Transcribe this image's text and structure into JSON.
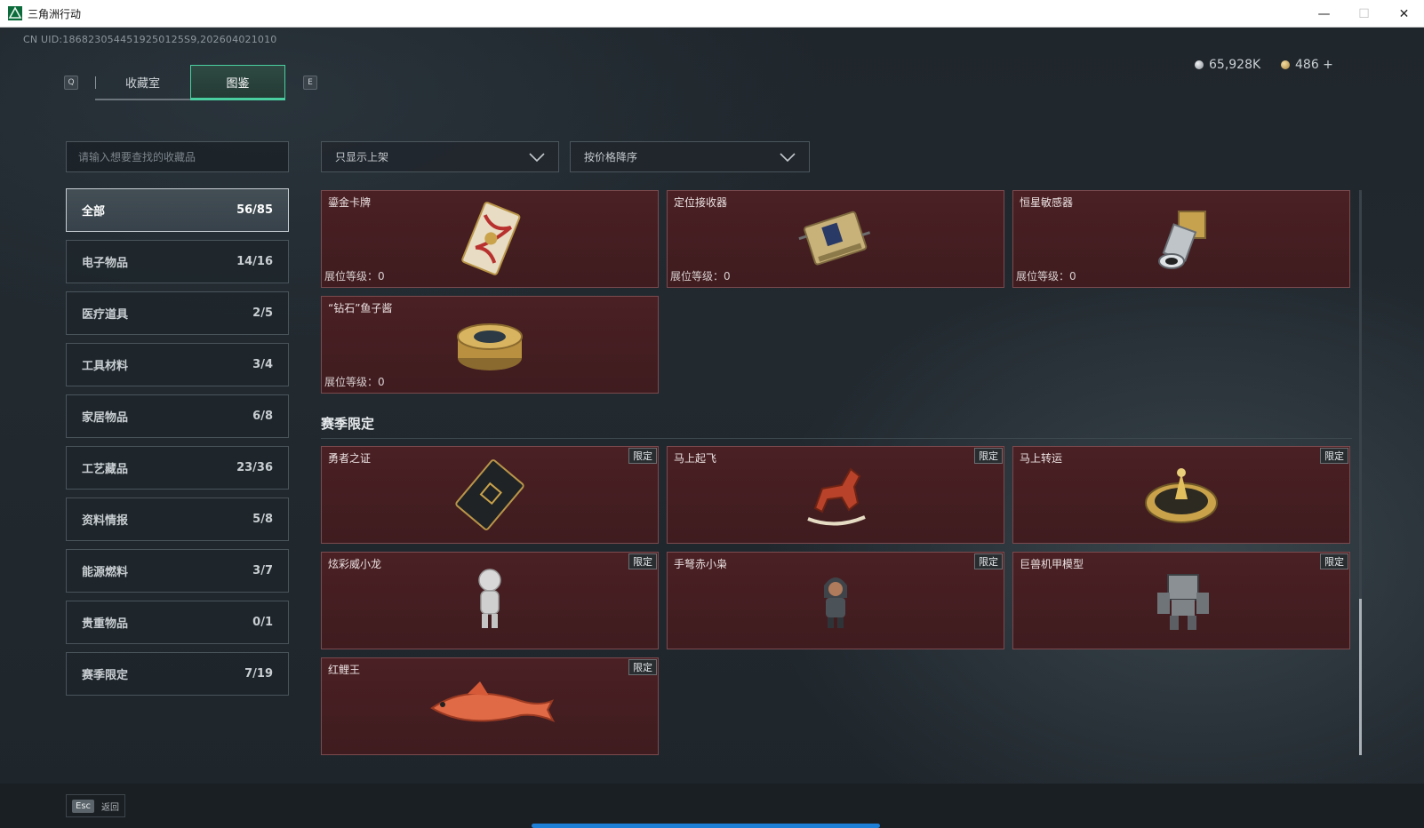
{
  "window": {
    "title": "三角洲行动",
    "minimize": "—",
    "maximize": "☐",
    "close": "✕"
  },
  "uid": "CN UID:1868230544519250125S9,202604021010",
  "keys": {
    "prev_tab": "Q",
    "next_tab": "E",
    "esc": "Esc"
  },
  "tabs": [
    {
      "label": "收藏室",
      "active": false
    },
    {
      "label": "图鉴",
      "active": true
    }
  ],
  "currency": {
    "silver": "65,928K",
    "gold": "486 +"
  },
  "search": {
    "placeholder": "请输入想要查找的收藏品"
  },
  "categories": [
    {
      "label": "全部",
      "count": "56/85",
      "active": true
    },
    {
      "label": "电子物品",
      "count": "14/16"
    },
    {
      "label": "医疗道具",
      "count": "2/5"
    },
    {
      "label": "工具材料",
      "count": "3/4"
    },
    {
      "label": "家居物品",
      "count": "6/8"
    },
    {
      "label": "工艺藏品",
      "count": "23/36"
    },
    {
      "label": "资料情报",
      "count": "5/8"
    },
    {
      "label": "能源燃料",
      "count": "3/7"
    },
    {
      "label": "贵重物品",
      "count": "0/1"
    },
    {
      "label": "赛季限定",
      "count": "7/19"
    }
  ],
  "filters": {
    "shelf": "只显示上架",
    "sort": "按价格降序"
  },
  "items": [
    {
      "name": "鎏金卡牌",
      "level": "展位等级：0",
      "icon": "gilded-card-icon"
    },
    {
      "name": "定位接收器",
      "level": "展位等级：0",
      "icon": "locator-receiver-icon"
    },
    {
      "name": "恒星敏感器",
      "level": "展位等级：0",
      "icon": "star-sensor-icon"
    },
    {
      "name": "“钻石”鱼子酱",
      "level": "展位等级：0",
      "icon": "caviar-tin-icon"
    }
  ],
  "section": {
    "title": "赛季限定",
    "badge": "限定"
  },
  "season_items": [
    {
      "name": "勇者之证",
      "icon": "brave-card-icon"
    },
    {
      "name": "马上起飞",
      "icon": "rocking-horse-icon"
    },
    {
      "name": "马上转运",
      "icon": "fortune-wheel-icon"
    },
    {
      "name": "炫彩威小龙",
      "icon": "dragon-figure-icon"
    },
    {
      "name": "手弩赤小枭",
      "icon": "owl-figure-icon"
    },
    {
      "name": "巨兽机甲模型",
      "icon": "mech-model-icon"
    },
    {
      "name": "红鲤王",
      "icon": "red-carp-icon"
    }
  ],
  "bottom": {
    "back": "返回"
  },
  "colors": {
    "accent": "#4ad0a0",
    "card_bg": "#4a2024",
    "progress": "#1e7fd6"
  }
}
